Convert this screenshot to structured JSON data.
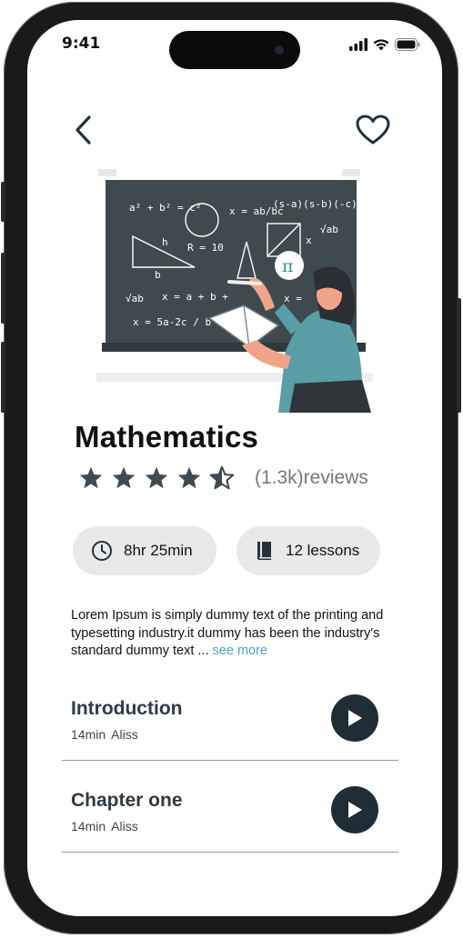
{
  "status": {
    "time": "9:41"
  },
  "course": {
    "title": "Mathematics",
    "rating": 4.5,
    "reviews": "(1.3k)reviews",
    "duration": "8hr 25min",
    "lessons": "12 lessons",
    "description": "Lorem Ipsum is simply dummy text of the printing and typesetting industry.it dummy has been the industry's standard dummy text ...",
    "see_more": "see more"
  },
  "board": {
    "formulas": [
      "a² + b² = c²",
      "x = ab/bc",
      "(s-a)(s-b)(-c)",
      "√ab",
      "h",
      "R = 10",
      "b",
      "x",
      "π",
      "√ab",
      "x = a + b +",
      "x = 5a-2c / b",
      "x ="
    ]
  },
  "chapters": [
    {
      "title": "Introduction",
      "duration": "14min",
      "author": "Aliss"
    },
    {
      "title": "Chapter one",
      "duration": "14min",
      "author": "Aliss"
    }
  ],
  "colors": {
    "accent": "#4aa5c4",
    "play": "#1f2d36",
    "chip": "#e9e9e8",
    "board": "#3e4a4e",
    "shirt": "#5a9ea6"
  },
  "icons": {
    "back": "chevron-left-icon",
    "favorite": "heart-icon",
    "clock": "clock-icon",
    "book": "book-icon",
    "play": "play-icon"
  }
}
